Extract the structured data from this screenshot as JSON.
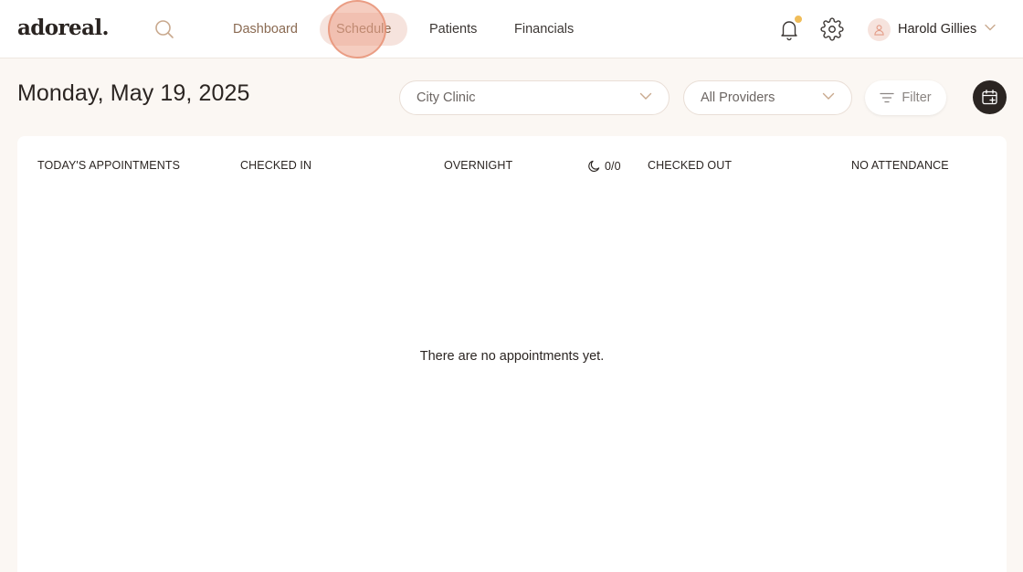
{
  "brand": {
    "name": "adoreal."
  },
  "nav": {
    "items": [
      {
        "label": "Dashboard"
      },
      {
        "label": "Schedule",
        "active": true
      },
      {
        "label": "Patients"
      },
      {
        "label": "Financials"
      }
    ]
  },
  "header_icons": {
    "search": "search-icon",
    "notifications": "bell-icon",
    "settings": "gear-icon",
    "has_unread_notification": true
  },
  "user": {
    "name": "Harold Gillies",
    "avatar_icon": "user-icon"
  },
  "toolbar": {
    "date": "Monday, May 19, 2025",
    "location_select": "City Clinic",
    "provider_select": "All Providers",
    "filter_label": "Filter",
    "calendar_icon": "calendar-add-icon"
  },
  "summary": {
    "columns": [
      {
        "label": "TODAY'S APPOINTMENTS"
      },
      {
        "label": "CHECKED IN"
      },
      {
        "label": "OVERNIGHT"
      },
      {
        "label": "CHECKED OUT"
      },
      {
        "label": "NO ATTENDANCE"
      }
    ],
    "overnight_count": "0/0",
    "overnight_icon": "moon-icon"
  },
  "empty_state": "There are no appointments yet.",
  "colors": {
    "page_background": "#fbf7f3",
    "accent_brown": "#8a6a52",
    "active_pill": "#f6e3dd",
    "notification_dot": "#f0bd59",
    "dark_button": "#2b2522"
  }
}
